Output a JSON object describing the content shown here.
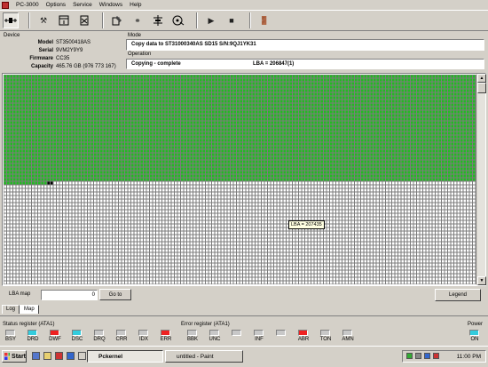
{
  "menu": {
    "items": [
      "PC-3000",
      "Options",
      "Service",
      "Windows",
      "Help"
    ]
  },
  "device": {
    "caption": "Device",
    "model_label": "Model",
    "model": "ST3500418AS",
    "serial_label": "Serial",
    "serial": "9VM2Y9Y9",
    "firmware_label": "Firmware",
    "firmware": "CC35",
    "capacity_label": "Capacity",
    "capacity": "465.76 GB (976 773 167)"
  },
  "mode": {
    "caption": "Mode",
    "text": "Copy data to ST31000340AS SD15 S/N:9QJ1YK31"
  },
  "operation": {
    "caption": "Operation",
    "status": "Copying - complete",
    "lba": "LBA = 206847(1)"
  },
  "map": {
    "tooltip": "LBA = 207435",
    "filled_fraction": 0.51,
    "colors": {
      "done": "#22bb22",
      "empty": "#ffffff",
      "current": "#000000",
      "border": "#7c7c7c"
    }
  },
  "lba_map": {
    "label": "LBA map",
    "value": "0",
    "goto_label": "Go to",
    "legend_label": "Legend"
  },
  "tabs": [
    {
      "label": "Log"
    },
    {
      "label": "Map"
    }
  ],
  "status_register": {
    "caption": "Status register (ATA1)",
    "bits": [
      {
        "name": "BSY",
        "color": "#c8c8c8"
      },
      {
        "name": "DRD",
        "color": "#33ccdd"
      },
      {
        "name": "DWF",
        "color": "#ee2222"
      },
      {
        "name": "DSC",
        "color": "#33ccdd"
      },
      {
        "name": "DRQ",
        "color": "#c8c8c8"
      },
      {
        "name": "CRR",
        "color": "#c8c8c8"
      },
      {
        "name": "IDX",
        "color": "#c8c8c8"
      },
      {
        "name": "ERR",
        "color": "#ee2222"
      }
    ]
  },
  "error_register": {
    "caption": "Error register (ATA1)",
    "bits": [
      {
        "name": "BBK",
        "color": "#c8c8c8"
      },
      {
        "name": "UNC",
        "color": "#c8c8c8"
      },
      {
        "name": "",
        "color": "#c8c8c8"
      },
      {
        "name": "INF",
        "color": "#c8c8c8"
      },
      {
        "name": "",
        "color": "#c8c8c8"
      },
      {
        "name": "ABR",
        "color": "#ee2222"
      },
      {
        "name": "TON",
        "color": "#c8c8c8"
      },
      {
        "name": "AMN",
        "color": "#c8c8c8"
      }
    ]
  },
  "power": {
    "caption": "Power",
    "label": "ON",
    "color": "#33ccdd"
  },
  "taskbar": {
    "start_label": "Start",
    "tasks": [
      {
        "label": "Pckernel"
      },
      {
        "label": "untitled - Paint"
      }
    ],
    "clock": "11:00 PM"
  }
}
